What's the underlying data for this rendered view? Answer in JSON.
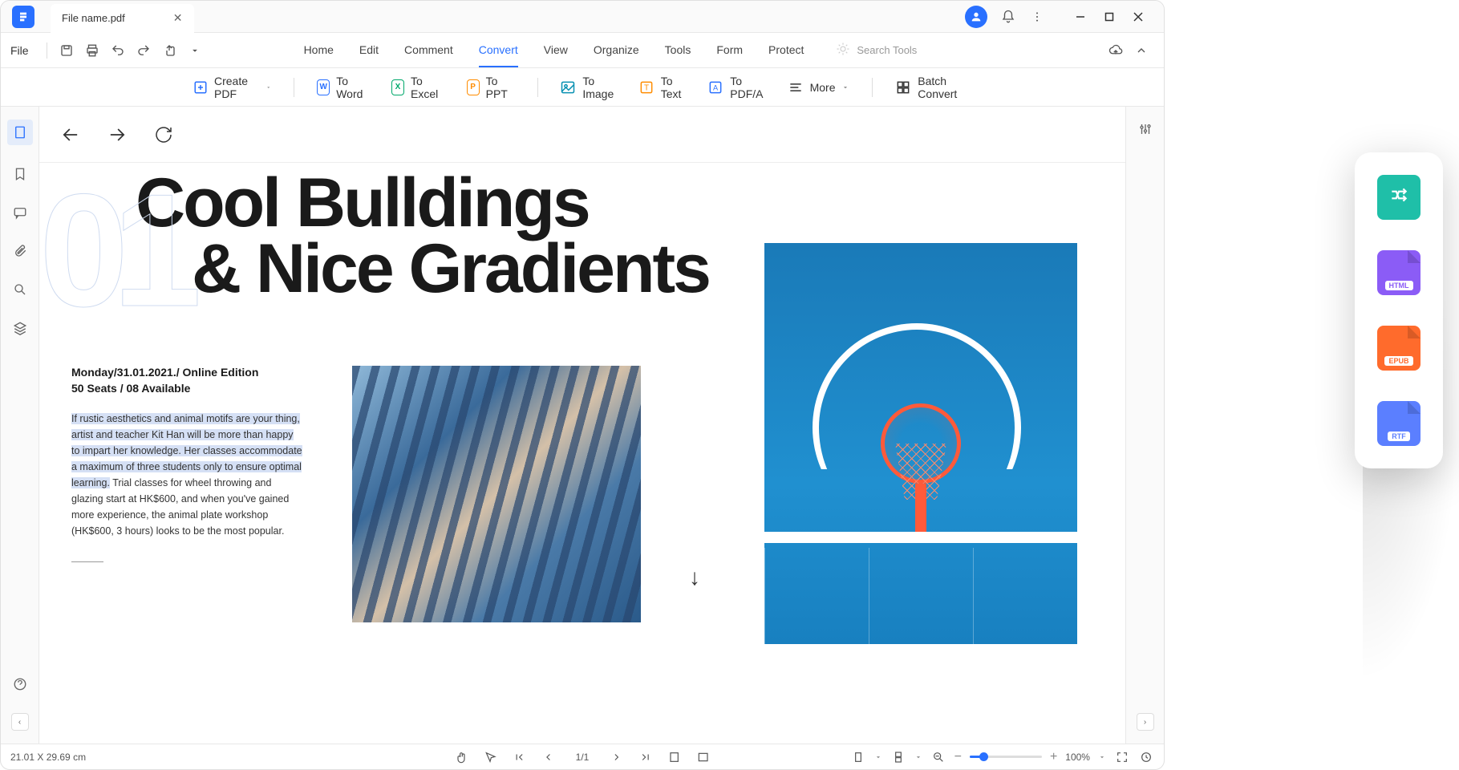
{
  "titlebar": {
    "file_name": "File name.pdf"
  },
  "menubar": {
    "file_label": "File",
    "search_placeholder": "Search Tools",
    "tabs": [
      "Home",
      "Edit",
      "Comment",
      "Convert",
      "View",
      "Organize",
      "Tools",
      "Form",
      "Protect"
    ],
    "active_tab": "Convert"
  },
  "toolbar": {
    "create_pdf": "Create PDF",
    "to_word": "To Word",
    "to_excel": "To Excel",
    "to_ppt": "To PPT",
    "to_image": "To Image",
    "to_text": "To Text",
    "to_pdfa": "To PDF/A",
    "more": "More",
    "batch": "Batch Convert"
  },
  "document": {
    "page_num": "01",
    "title_line1": "Cool Bulldings",
    "title_line2": "& Nice Gradients",
    "date_line": "Monday/31.01.2021./ Online Edition",
    "seats_line": "50 Seats / 08 Available",
    "body_highlighted": "If rustic aesthetics and animal motifs are your thing, artist and teacher Kit Han will be more than happy to impart her knowledge. Her classes accommodate a maximum of three students only to ensure optimal learning.",
    "body_rest": " Trial classes for wheel throwing and glazing start at HK$600, and when you've gained more experience, the animal plate workshop (HK$600, 3 hours) looks to be the most popular."
  },
  "statusbar": {
    "dimensions": "21.01 X 29.69 cm",
    "page_indicator": "1/1",
    "zoom_percent": "100%"
  },
  "floating": {
    "html_label": "HTML",
    "epub_label": "EPUB",
    "rtf_label": "RTF"
  }
}
